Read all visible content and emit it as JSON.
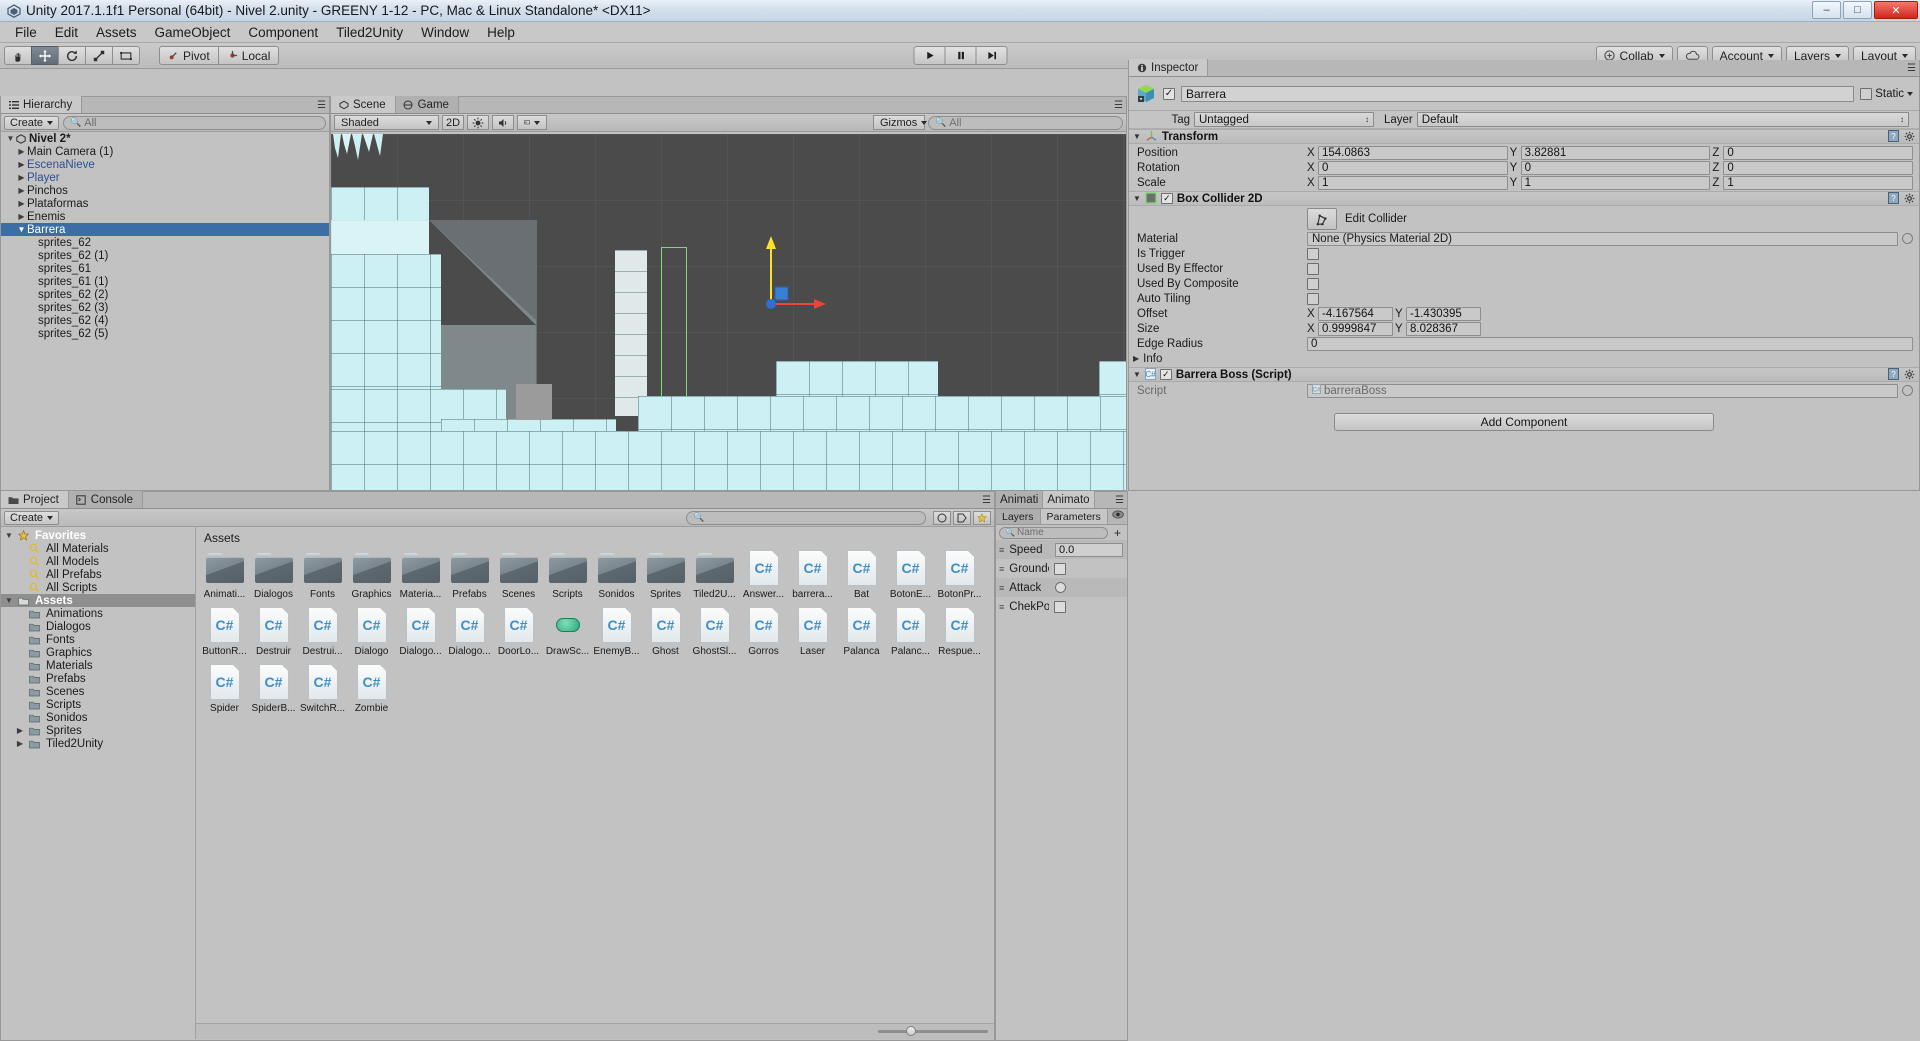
{
  "window": {
    "title": "Unity 2017.1.1f1 Personal (64bit) - Nivel 2.unity - GREENY 1-12 - PC, Mac & Linux Standalone* <DX11>",
    "minimize": "–",
    "maximize": "□",
    "close": "✕"
  },
  "menu": {
    "items": [
      "File",
      "Edit",
      "Assets",
      "GameObject",
      "Component",
      "Tiled2Unity",
      "Window",
      "Help"
    ]
  },
  "toolbar": {
    "tools": [
      "hand-tool",
      "move-tool",
      "rotate-tool",
      "scale-tool",
      "rect-tool"
    ],
    "pivot_label": "Pivot",
    "local_label": "Local",
    "play_label": "▶",
    "pause_label": "❙❙",
    "step_label": "▶❙",
    "collab_label": "Collab",
    "cloud_label": "cloud-icon",
    "account_label": "Account",
    "layers_label": "Layers",
    "layout_label": "Layout"
  },
  "hierarchy": {
    "tab_label": "Hierarchy",
    "create_label": "Create",
    "search_placeholder": "All",
    "items": [
      {
        "label": "Nivel 2*",
        "depth": 0,
        "expanded": true,
        "kind": "scene",
        "selected": false
      },
      {
        "label": "Main Camera (1)",
        "depth": 1,
        "expanded": false,
        "kind": "object",
        "selected": false
      },
      {
        "label": "EscenaNieve",
        "depth": 1,
        "expanded": false,
        "kind": "prefab",
        "selected": false
      },
      {
        "label": "Player",
        "depth": 1,
        "expanded": false,
        "kind": "prefab",
        "selected": false
      },
      {
        "label": "Pinchos",
        "depth": 1,
        "expanded": false,
        "kind": "object",
        "selected": false
      },
      {
        "label": "Plataformas",
        "depth": 1,
        "expanded": false,
        "kind": "object",
        "selected": false
      },
      {
        "label": "Enemis",
        "depth": 1,
        "expanded": false,
        "kind": "object",
        "selected": false
      },
      {
        "label": "Barrera",
        "depth": 1,
        "expanded": true,
        "kind": "object",
        "selected": true
      },
      {
        "label": "sprites_62",
        "depth": 2,
        "expanded": null,
        "kind": "object",
        "selected": false
      },
      {
        "label": "sprites_62 (1)",
        "depth": 2,
        "expanded": null,
        "kind": "object",
        "selected": false
      },
      {
        "label": "sprites_61",
        "depth": 2,
        "expanded": null,
        "kind": "object",
        "selected": false
      },
      {
        "label": "sprites_61 (1)",
        "depth": 2,
        "expanded": null,
        "kind": "object",
        "selected": false
      },
      {
        "label": "sprites_62 (2)",
        "depth": 2,
        "expanded": null,
        "kind": "object",
        "selected": false
      },
      {
        "label": "sprites_62 (3)",
        "depth": 2,
        "expanded": null,
        "kind": "object",
        "selected": false
      },
      {
        "label": "sprites_62 (4)",
        "depth": 2,
        "expanded": null,
        "kind": "object",
        "selected": false
      },
      {
        "label": "sprites_62 (5)",
        "depth": 2,
        "expanded": null,
        "kind": "object",
        "selected": false
      }
    ]
  },
  "scene": {
    "tab_label": "Scene",
    "game_tab_label": "Game",
    "shading_label": "Shaded",
    "mode_2d_label": "2D",
    "gizmos_label": "Gizmos",
    "search_placeholder": "All"
  },
  "inspector": {
    "tab_label": "Inspector",
    "object_name": "Barrera",
    "static_label": "Static",
    "tag_label": "Tag",
    "tag_value": "Untagged",
    "layer_label": "Layer",
    "layer_value": "Default",
    "transform": {
      "title": "Transform",
      "rows": [
        {
          "name": "Position",
          "x": "154.0863",
          "y": "3.82881",
          "z": "0"
        },
        {
          "name": "Rotation",
          "x": "0",
          "y": "0",
          "z": "0"
        },
        {
          "name": "Scale",
          "x": "1",
          "y": "1",
          "z": "1"
        }
      ]
    },
    "box_collider": {
      "title": "Box Collider 2D",
      "enabled": true,
      "edit_collider_label": "Edit Collider",
      "material_label": "Material",
      "material_value": "None (Physics Material 2D)",
      "is_trigger_label": "Is Trigger",
      "used_by_effector_label": "Used By Effector",
      "used_by_composite_label": "Used By Composite",
      "auto_tiling_label": "Auto Tiling",
      "offset_label": "Offset",
      "offset_x": "-4.167564",
      "offset_y": "-1.430395",
      "size_label": "Size",
      "size_x": "0.9999847",
      "size_y": "8.028367",
      "edge_radius_label": "Edge Radius",
      "edge_radius_value": "0",
      "info_label": "Info"
    },
    "script_component": {
      "title": "Barrera Boss (Script)",
      "enabled": true,
      "script_label": "Script",
      "script_value": "barreraBoss"
    },
    "add_component_label": "Add Component"
  },
  "project": {
    "tab_label": "Project",
    "console_tab_label": "Console",
    "create_label": "Create",
    "search_placeholder": "",
    "assets_label": "Assets",
    "tree": [
      {
        "label": "Favorites",
        "depth": 0,
        "kind": "star",
        "expanded": true,
        "header": true
      },
      {
        "label": "All Materials",
        "depth": 1,
        "kind": "search"
      },
      {
        "label": "All Models",
        "depth": 1,
        "kind": "search"
      },
      {
        "label": "All Prefabs",
        "depth": 1,
        "kind": "search"
      },
      {
        "label": "All Scripts",
        "depth": 1,
        "kind": "search"
      },
      {
        "label": "Assets",
        "depth": 0,
        "kind": "folder",
        "expanded": true,
        "header": true,
        "selected": true
      },
      {
        "label": "Animations",
        "depth": 1,
        "kind": "folder"
      },
      {
        "label": "Dialogos",
        "depth": 1,
        "kind": "folder"
      },
      {
        "label": "Fonts",
        "depth": 1,
        "kind": "folder"
      },
      {
        "label": "Graphics",
        "depth": 1,
        "kind": "folder"
      },
      {
        "label": "Materials",
        "depth": 1,
        "kind": "folder"
      },
      {
        "label": "Prefabs",
        "depth": 1,
        "kind": "folder"
      },
      {
        "label": "Scenes",
        "depth": 1,
        "kind": "folder"
      },
      {
        "label": "Scripts",
        "depth": 1,
        "kind": "folder"
      },
      {
        "label": "Sonidos",
        "depth": 1,
        "kind": "folder"
      },
      {
        "label": "Sprites",
        "depth": 1,
        "kind": "folder",
        "expandable": true
      },
      {
        "label": "Tiled2Unity",
        "depth": 1,
        "kind": "folder",
        "expandable": true
      }
    ],
    "assets": [
      {
        "name": "Animati...",
        "type": "folder"
      },
      {
        "name": "Dialogos",
        "type": "folder"
      },
      {
        "name": "Fonts",
        "type": "folder"
      },
      {
        "name": "Graphics",
        "type": "folder"
      },
      {
        "name": "Materia...",
        "type": "folder"
      },
      {
        "name": "Prefabs",
        "type": "folder"
      },
      {
        "name": "Scenes",
        "type": "folder"
      },
      {
        "name": "Scripts",
        "type": "folder"
      },
      {
        "name": "Sonidos",
        "type": "folder"
      },
      {
        "name": "Sprites",
        "type": "folder"
      },
      {
        "name": "Tiled2U...",
        "type": "folder"
      },
      {
        "name": "Answer...",
        "type": "script"
      },
      {
        "name": "barrera...",
        "type": "script"
      },
      {
        "name": "Bat",
        "type": "script"
      },
      {
        "name": "BotonE...",
        "type": "script"
      },
      {
        "name": "BotonPr...",
        "type": "script"
      },
      {
        "name": "ButtonR...",
        "type": "script"
      },
      {
        "name": "Destruir",
        "type": "script"
      },
      {
        "name": "Destrui...",
        "type": "script"
      },
      {
        "name": "Dialogo",
        "type": "script"
      },
      {
        "name": "Dialogo...",
        "type": "script"
      },
      {
        "name": "Dialogo...",
        "type": "script"
      },
      {
        "name": "DoorLo...",
        "type": "script"
      },
      {
        "name": "DrawSc...",
        "type": "prefab"
      },
      {
        "name": "EnemyB...",
        "type": "script"
      },
      {
        "name": "Ghost",
        "type": "script"
      },
      {
        "name": "GhostSl...",
        "type": "script"
      },
      {
        "name": "Gorros",
        "type": "script"
      },
      {
        "name": "Laser",
        "type": "script"
      },
      {
        "name": "Palanca",
        "type": "script"
      },
      {
        "name": "Palanc...",
        "type": "script"
      },
      {
        "name": "Respue...",
        "type": "script"
      },
      {
        "name": "Spider",
        "type": "script"
      },
      {
        "name": "SpiderB...",
        "type": "script"
      },
      {
        "name": "SwitchR...",
        "type": "script"
      },
      {
        "name": "Zombie",
        "type": "script"
      }
    ]
  },
  "animator": {
    "tab_animation_label": "Animati",
    "tab_animator_label": "Animato",
    "layers_tab_label": "Layers",
    "parameters_tab_label": "Parameters",
    "search_placeholder": "Name",
    "add_label": "+",
    "parameters": [
      {
        "name": "Speed",
        "type": "float",
        "value": "0.0"
      },
      {
        "name": "Grounded",
        "type": "bool",
        "value": false
      },
      {
        "name": "Attack",
        "type": "trigger",
        "value": false
      },
      {
        "name": "ChekPoint",
        "type": "bool",
        "value": false
      }
    ]
  },
  "colors": {
    "selection_blue": "#3a6ea5",
    "prefab_blue": "#2b4f95",
    "collider_green": "#76e06a",
    "gizmo_y": "#ffe02a",
    "gizmo_x": "#e8453c",
    "scene_bg": "#4b4b4b",
    "ice": "#cdf0f5"
  }
}
